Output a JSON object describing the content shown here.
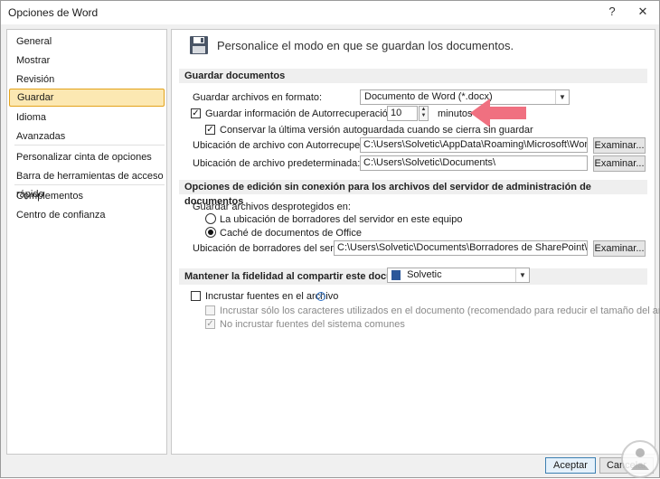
{
  "window": {
    "title": "Opciones de Word",
    "help": "?",
    "close": "✕"
  },
  "sidebar": {
    "items": [
      {
        "label": "General"
      },
      {
        "label": "Mostrar"
      },
      {
        "label": "Revisión"
      },
      {
        "label": "Guardar"
      },
      {
        "label": "Idioma"
      },
      {
        "label": "Avanzadas"
      },
      {
        "label": "Personalizar cinta de opciones"
      },
      {
        "label": "Barra de herramientas de acceso rápido"
      },
      {
        "label": "Complementos"
      },
      {
        "label": "Centro de confianza"
      }
    ],
    "selected": "Guardar"
  },
  "main": {
    "header": "Personalice el modo en que se guardan los documentos.",
    "save_section": {
      "title": "Guardar documentos",
      "format_label": "Guardar archivos en formato:",
      "format_value": "Documento de Word (*.docx)",
      "autorecover_label": "Guardar información de Autorrecuperación cada",
      "autorecover_minutes": "10",
      "minutes_label": "minutos",
      "keep_last_label": "Conservar la última versión autoguardada cuando se cierra sin guardar",
      "autorecover_location_label": "Ubicación de archivo con Autorrecuperación:",
      "autorecover_location_value": "C:\\Users\\Solvetic\\AppData\\Roaming\\Microsoft\\Word\\",
      "default_location_label": "Ubicación de archivo predeterminada:",
      "default_location_value": "C:\\Users\\Solvetic\\Documents\\",
      "browse_label": "Examinar..."
    },
    "offline_section": {
      "title": "Opciones de edición sin conexión para los archivos del servidor de administración de documentos",
      "checked_out_label": "Guardar archivos desprotegidos en:",
      "option_server": "La ubicación de borradores del servidor en este equipo",
      "option_cache": "Caché de documentos de Office",
      "drafts_label": "Ubicación de borradores del servidor:",
      "drafts_value": "C:\\Users\\Solvetic\\Documents\\Borradores de SharePoint\\",
      "browse_label": "Examinar..."
    },
    "fidelity_section": {
      "title": "Mantener la fidelidad al compartir este documento:",
      "document_value": "Solvetic",
      "embed_fonts_label": "Incrustar fuentes en el archivo",
      "embed_used_label": "Incrustar sólo los caracteres utilizados en el documento (recomendado para reducir el tamaño del archivo)",
      "no_common_label": "No incrustar fuentes del sistema comunes"
    }
  },
  "footer": {
    "ok": "Aceptar",
    "cancel": "Cancelar"
  },
  "colors": {
    "selected_bg": "#fce8b2",
    "selected_border": "#e3a21a",
    "annotation_arrow": "#f07080"
  }
}
